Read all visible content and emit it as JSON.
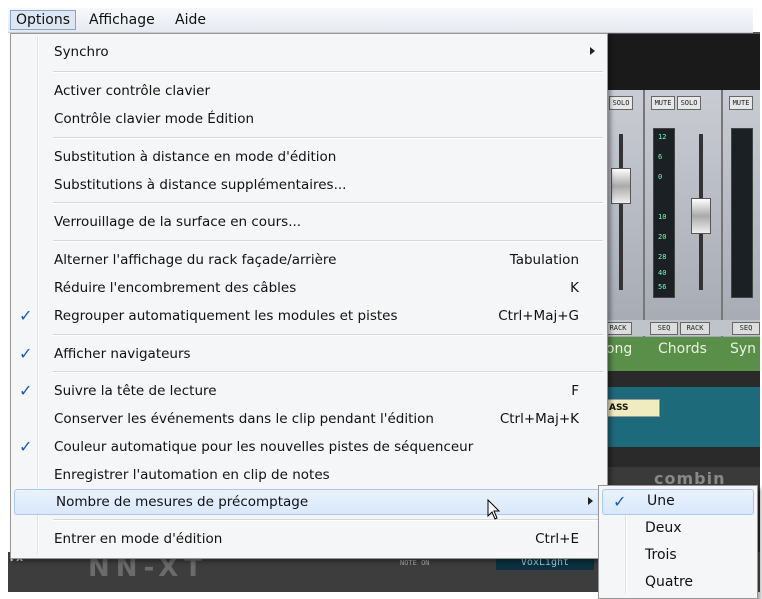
{
  "menubar": {
    "items": [
      "Options",
      "Affichage",
      "Aide"
    ]
  },
  "menu": {
    "items": [
      {
        "label": "Synchro",
        "shortcut": "",
        "checked": false,
        "submenu": true
      },
      {
        "label": "Activer contrôle clavier",
        "shortcut": "",
        "checked": false
      },
      {
        "label": "Contrôle clavier mode Édition",
        "shortcut": "",
        "checked": false
      },
      {
        "label": "Substitution à distance en mode d'édition",
        "shortcut": "",
        "checked": false
      },
      {
        "label": "Substitutions à distance supplémentaires...",
        "shortcut": "",
        "checked": false
      },
      {
        "label": "Verrouillage de la surface en cours...",
        "shortcut": "",
        "checked": false
      },
      {
        "label": "Alterner l'affichage du rack façade/arrière",
        "shortcut": "Tabulation",
        "checked": false
      },
      {
        "label": "Réduire l'encombrement des câbles",
        "shortcut": "K",
        "checked": false
      },
      {
        "label": "Regrouper automatiquement les modules et pistes",
        "shortcut": "Ctrl+Maj+G",
        "checked": true
      },
      {
        "label": "Afficher navigateurs",
        "shortcut": "",
        "checked": true
      },
      {
        "label": "Suivre la tête de lecture",
        "shortcut": "F",
        "checked": true
      },
      {
        "label": "Conserver les événements dans le clip pendant l'édition",
        "shortcut": "Ctrl+Maj+K",
        "checked": false
      },
      {
        "label": "Couleur automatique pour les nouvelles pistes de séquenceur",
        "shortcut": "",
        "checked": true
      },
      {
        "label": "Enregistrer l'automation en clip de notes",
        "shortcut": "",
        "checked": false
      },
      {
        "label": "Nombre de mesures de précomptage",
        "shortcut": "",
        "checked": false,
        "submenu": true
      },
      {
        "label": "Entrer en mode d'édition",
        "shortcut": "Ctrl+E",
        "checked": false
      }
    ],
    "check_glyph": "✓"
  },
  "submenu": {
    "items": [
      {
        "label": "Une",
        "checked": true
      },
      {
        "label": "Deux",
        "checked": false
      },
      {
        "label": "Trois",
        "checked": false
      },
      {
        "label": "Quatre",
        "checked": false
      }
    ]
  },
  "background_app": {
    "channel_buttons": [
      "MUTE",
      "SOLO"
    ],
    "meter_ticks": [
      "12",
      "6",
      "0",
      "10",
      "20",
      "28",
      "40",
      "56"
    ],
    "rack_buttons": [
      "SEQ",
      "RACK"
    ],
    "channel_labels": [
      "long",
      "Chords",
      "Syn"
    ],
    "seq_track_label": "ASS",
    "combinator_text": "combin",
    "device_fx_label": "FX",
    "device_name": "NN-XT",
    "note_on_label": "NOTE ON",
    "patch_name": "VoxLight"
  },
  "colors": {
    "accent": "#1b56c4",
    "highlight": "#d9e8fb",
    "highlight_border": "#a8c8ef"
  }
}
